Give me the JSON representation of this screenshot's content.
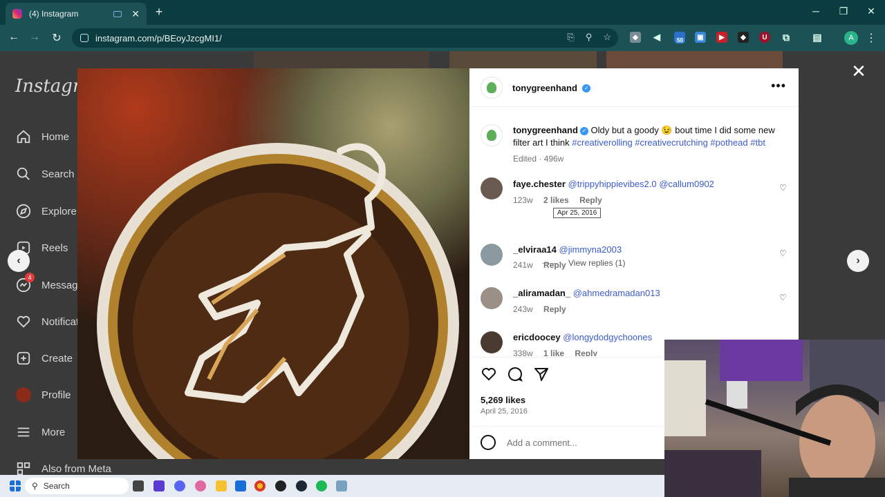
{
  "browser": {
    "tab_title": "(4) Instagram",
    "url": "instagram.com/p/BEoyJzcgMI1/",
    "profile_initial": "A",
    "extension_badge": "50"
  },
  "sidebar": {
    "logo": "Instagram",
    "items": [
      {
        "label": "Home",
        "icon": "home-icon"
      },
      {
        "label": "Search",
        "icon": "search-icon"
      },
      {
        "label": "Explore",
        "icon": "compass-icon"
      },
      {
        "label": "Reels",
        "icon": "reels-icon"
      },
      {
        "label": "Messages",
        "icon": "messenger-icon",
        "badge": "4"
      },
      {
        "label": "Notifications",
        "icon": "heart-icon"
      },
      {
        "label": "Create",
        "icon": "plus-square-icon"
      },
      {
        "label": "Profile",
        "icon": "avatar"
      },
      {
        "label": "More",
        "icon": "menu-icon"
      },
      {
        "label": "Also from Meta",
        "icon": "meta-apps-icon"
      }
    ]
  },
  "post": {
    "author": "tonygreenhand",
    "caption_text": "Oldy but a goody 😉 bout time I did some new filter art I think",
    "hashtags": "#creativerolling #creativecrutching #pothead #tbt",
    "caption_meta": "Edited · 496w",
    "tooltip": "Apr 25, 2016",
    "likes": "5,269 likes",
    "date": "April 25, 2016",
    "comment_placeholder": "Add a comment..."
  },
  "comments": [
    {
      "user": "faye.chester",
      "text": "@trippyhippievibes2.0 @callum0902",
      "age": "123w",
      "likes": "2 likes",
      "reply": "Reply",
      "view_replies": "View replies (1)"
    },
    {
      "user": "_elviraa14",
      "text": "@jimmyna2003",
      "age": "241w",
      "reply": "Reply"
    },
    {
      "user": "_aliramadan_",
      "text": "@ahmedramadan013",
      "age": "243w",
      "reply": "Reply"
    },
    {
      "user": "ericdoocey",
      "text": "@longydodgychoones",
      "age": "338w",
      "likes": "1 like",
      "reply": "Reply"
    }
  ],
  "taskbar": {
    "search_label": "Search"
  }
}
